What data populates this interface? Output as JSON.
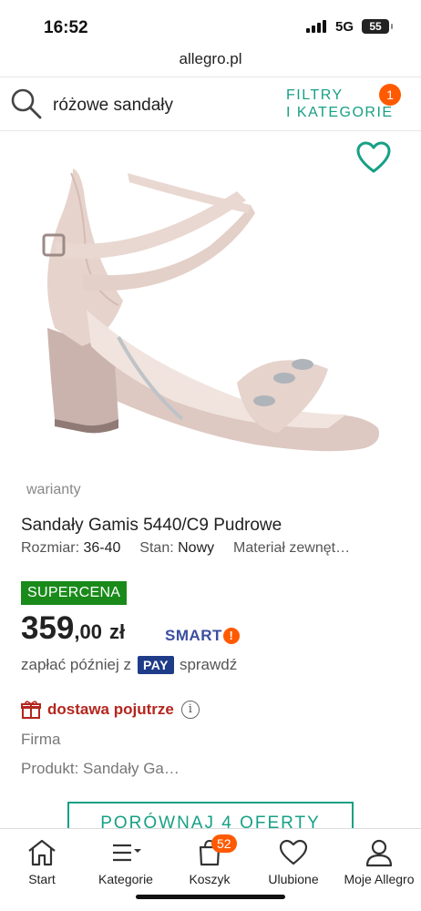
{
  "status_bar": {
    "time": "16:52",
    "network": "5G",
    "battery": "55"
  },
  "browser": {
    "url": "allegro.pl"
  },
  "search": {
    "query": "różowe sandały",
    "filters_line1": "FILTRY",
    "filters_line2": "I KATEGORIE",
    "filters_count": "1"
  },
  "product": {
    "variants_label": "warianty",
    "title": "Sandały Gamis 5440/C9 Pudrowe",
    "params": [
      {
        "label": "Rozmiar:",
        "value": "36-40"
      },
      {
        "label": "Stan:",
        "value": "Nowy"
      },
      {
        "label": "Materiał zewnęt…",
        "value": ""
      }
    ],
    "badge": "SUPERCENA",
    "price_int": "359",
    "price_dec": ",00",
    "currency": "zł",
    "smart_label": "SMART",
    "smart_mark": "!",
    "paylater_prefix": "zapłać później z",
    "pay_badge": "PAY",
    "paylater_suffix": "sprawdź",
    "delivery": "dostawa pojutrze",
    "info_mark": "i",
    "seller_type": "Firma",
    "produkt_line": "Produkt: Sandały Ga…",
    "compare_button": "PORÓWNAJ 4 OFERTY"
  },
  "bottom_nav": {
    "items": [
      {
        "label": "Start",
        "icon": "home-icon"
      },
      {
        "label": "Kategorie",
        "icon": "categories-icon"
      },
      {
        "label": "Koszyk",
        "icon": "cart-icon"
      },
      {
        "label": "Ulubione",
        "icon": "heart-icon"
      },
      {
        "label": "Moje Allegro",
        "icon": "user-icon"
      }
    ],
    "cart_count": "52"
  },
  "colors": {
    "accent": "#16a085",
    "orange": "#ff5a00",
    "supercena": "#1a8a1a",
    "delivery": "#b3261e",
    "pay": "#1f3c88"
  }
}
